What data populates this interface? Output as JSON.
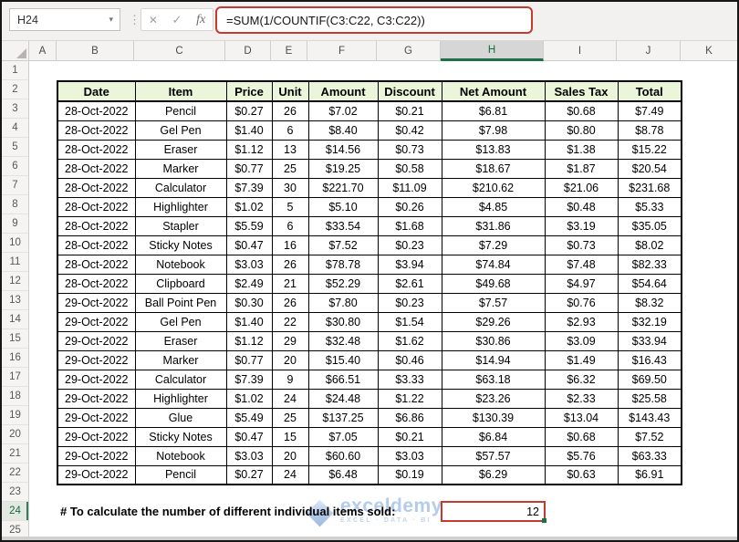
{
  "formula_bar": {
    "name_box_value": "H24",
    "name_box_caret": "▾",
    "drag_handle": "⋮",
    "cancel_label": "✕",
    "enter_label": "✓",
    "fx_label": "fx",
    "formula": "=SUM(1/COUNTIF(C3:C22, C3:C22))"
  },
  "colors": {
    "accent_red": "#c43a2e",
    "excel_green": "#1e7145",
    "table_header_fill": "#ebf5da",
    "watermark_blue": "#b4cbe9"
  },
  "sheet": {
    "active_cell": "H24",
    "column_headers": [
      {
        "label": "A"
      },
      {
        "label": "B"
      },
      {
        "label": "C"
      },
      {
        "label": "D"
      },
      {
        "label": "E"
      },
      {
        "label": "F"
      },
      {
        "label": "G"
      },
      {
        "label": "H",
        "class": "active"
      },
      {
        "label": "I"
      },
      {
        "label": "J"
      },
      {
        "label": "K"
      }
    ],
    "row_headers": [
      {
        "n": "1"
      },
      {
        "n": "2"
      },
      {
        "n": "3"
      },
      {
        "n": "4"
      },
      {
        "n": "5"
      },
      {
        "n": "6"
      },
      {
        "n": "7"
      },
      {
        "n": "8"
      },
      {
        "n": "9"
      },
      {
        "n": "10"
      },
      {
        "n": "11"
      },
      {
        "n": "12"
      },
      {
        "n": "13"
      },
      {
        "n": "14"
      },
      {
        "n": "15"
      },
      {
        "n": "16"
      },
      {
        "n": "17"
      },
      {
        "n": "18"
      },
      {
        "n": "19"
      },
      {
        "n": "20"
      },
      {
        "n": "21"
      },
      {
        "n": "22"
      },
      {
        "n": "23"
      },
      {
        "n": "24",
        "class": "active"
      },
      {
        "n": "25"
      }
    ]
  },
  "table": {
    "headers": [
      "Date",
      "Item",
      "Price",
      "Unit",
      "Amount",
      "Discount",
      "Net Amount",
      "Sales Tax",
      "Total"
    ],
    "rows": [
      [
        "28-Oct-2022",
        "Pencil",
        "$0.27",
        "26",
        "$7.02",
        "$0.21",
        "$6.81",
        "$0.68",
        "$7.49"
      ],
      [
        "28-Oct-2022",
        "Gel Pen",
        "$1.40",
        "6",
        "$8.40",
        "$0.42",
        "$7.98",
        "$0.80",
        "$8.78"
      ],
      [
        "28-Oct-2022",
        "Eraser",
        "$1.12",
        "13",
        "$14.56",
        "$0.73",
        "$13.83",
        "$1.38",
        "$15.22"
      ],
      [
        "28-Oct-2022",
        "Marker",
        "$0.77",
        "25",
        "$19.25",
        "$0.58",
        "$18.67",
        "$1.87",
        "$20.54"
      ],
      [
        "28-Oct-2022",
        "Calculator",
        "$7.39",
        "30",
        "$221.70",
        "$11.09",
        "$210.62",
        "$21.06",
        "$231.68"
      ],
      [
        "28-Oct-2022",
        "Highlighter",
        "$1.02",
        "5",
        "$5.10",
        "$0.26",
        "$4.85",
        "$0.48",
        "$5.33"
      ],
      [
        "28-Oct-2022",
        "Stapler",
        "$5.59",
        "6",
        "$33.54",
        "$1.68",
        "$31.86",
        "$3.19",
        "$35.05"
      ],
      [
        "28-Oct-2022",
        "Sticky Notes",
        "$0.47",
        "16",
        "$7.52",
        "$0.23",
        "$7.29",
        "$0.73",
        "$8.02"
      ],
      [
        "28-Oct-2022",
        "Notebook",
        "$3.03",
        "26",
        "$78.78",
        "$3.94",
        "$74.84",
        "$7.48",
        "$82.33"
      ],
      [
        "28-Oct-2022",
        "Clipboard",
        "$2.49",
        "21",
        "$52.29",
        "$2.61",
        "$49.68",
        "$4.97",
        "$54.64"
      ],
      [
        "29-Oct-2022",
        "Ball Point Pen",
        "$0.30",
        "26",
        "$7.80",
        "$0.23",
        "$7.57",
        "$0.76",
        "$8.32"
      ],
      [
        "29-Oct-2022",
        "Gel Pen",
        "$1.40",
        "22",
        "$30.80",
        "$1.54",
        "$29.26",
        "$2.93",
        "$32.19"
      ],
      [
        "29-Oct-2022",
        "Eraser",
        "$1.12",
        "29",
        "$32.48",
        "$1.62",
        "$30.86",
        "$3.09",
        "$33.94"
      ],
      [
        "29-Oct-2022",
        "Marker",
        "$0.77",
        "20",
        "$15.40",
        "$0.46",
        "$14.94",
        "$1.49",
        "$16.43"
      ],
      [
        "29-Oct-2022",
        "Calculator",
        "$7.39",
        "9",
        "$66.51",
        "$3.33",
        "$63.18",
        "$6.32",
        "$69.50"
      ],
      [
        "29-Oct-2022",
        "Highlighter",
        "$1.02",
        "24",
        "$24.48",
        "$1.22",
        "$23.26",
        "$2.33",
        "$25.58"
      ],
      [
        "29-Oct-2022",
        "Glue",
        "$5.49",
        "25",
        "$137.25",
        "$6.86",
        "$130.39",
        "$13.04",
        "$143.43"
      ],
      [
        "29-Oct-2022",
        "Sticky Notes",
        "$0.47",
        "15",
        "$7.05",
        "$0.21",
        "$6.84",
        "$0.68",
        "$7.52"
      ],
      [
        "29-Oct-2022",
        "Notebook",
        "$3.03",
        "20",
        "$60.60",
        "$3.03",
        "$57.57",
        "$5.76",
        "$63.33"
      ],
      [
        "29-Oct-2022",
        "Pencil",
        "$0.27",
        "24",
        "$6.48",
        "$0.19",
        "$6.29",
        "$0.63",
        "$6.91"
      ]
    ]
  },
  "note": {
    "label": "# To calculate the number of different individual items sold:",
    "result_value": "12"
  },
  "watermark": {
    "brand": "exceldemy",
    "tagline": "EXCEL · DATA · BI"
  }
}
